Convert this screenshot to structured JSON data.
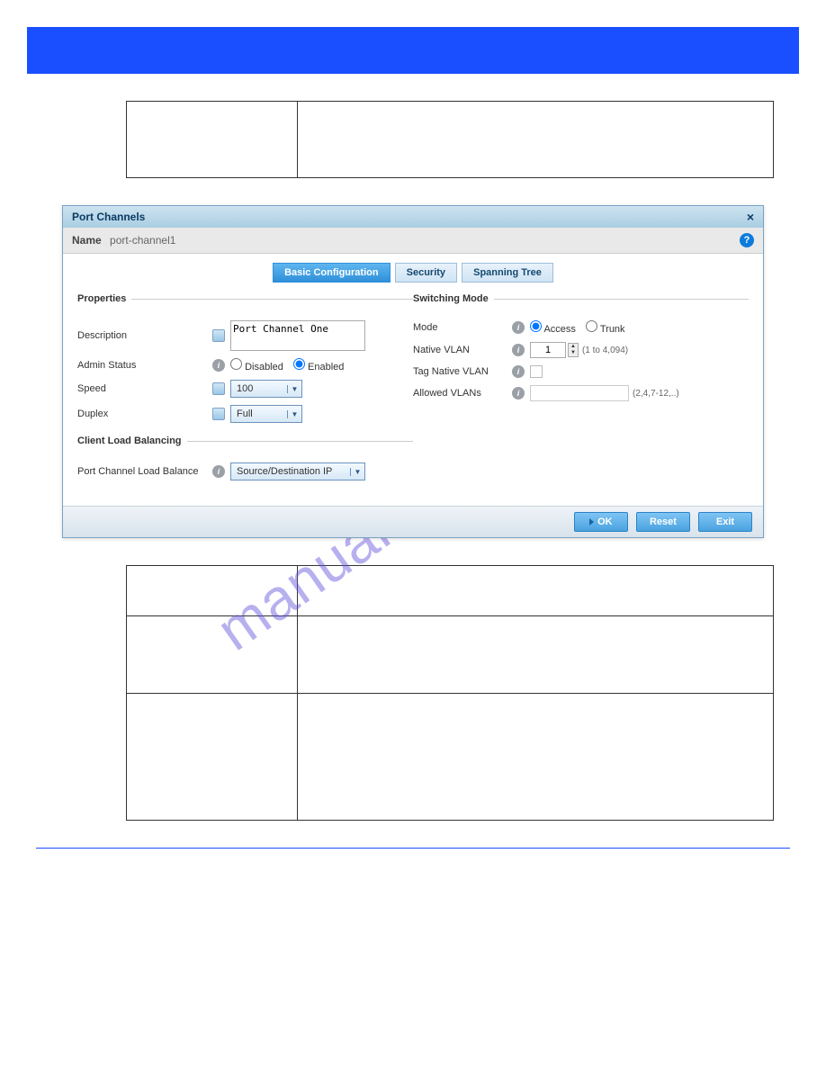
{
  "watermark": "manualshive.com",
  "top_table": {
    "left": "",
    "right": ""
  },
  "dialog": {
    "title": "Port Channels",
    "close_glyph": "×",
    "name_label": "Name",
    "name_value": "port-channel1",
    "help_glyph": "?",
    "tabs": {
      "basic": "Basic Configuration",
      "security": "Security",
      "spanning": "Spanning Tree"
    },
    "props": {
      "legend": "Properties",
      "description_label": "Description",
      "description_value": "Port Channel One",
      "admin_status_label": "Admin Status",
      "admin_disabled": "Disabled",
      "admin_enabled": "Enabled",
      "speed_label": "Speed",
      "speed_value": "100",
      "duplex_label": "Duplex",
      "duplex_value": "Full"
    },
    "clb": {
      "legend": "Client Load Balancing",
      "pclb_label": "Port Channel Load Balance",
      "pclb_value": "Source/Destination IP"
    },
    "switching": {
      "legend": "Switching Mode",
      "mode_label": "Mode",
      "mode_access": "Access",
      "mode_trunk": "Trunk",
      "native_vlan_label": "Native VLAN",
      "native_vlan_value": "1",
      "native_vlan_hint": "(1 to 4,094)",
      "tag_native_label": "Tag Native VLAN",
      "allowed_label": "Allowed VLANs",
      "allowed_hint": "(2,4,7-12,..)"
    },
    "buttons": {
      "ok": "OK",
      "reset": "Reset",
      "exit": "Exit"
    }
  },
  "bottom_table": {
    "row0_left": "",
    "row0_right": "",
    "row1_left": "",
    "row1_right": "",
    "row2_left": "",
    "row2_right": ""
  }
}
